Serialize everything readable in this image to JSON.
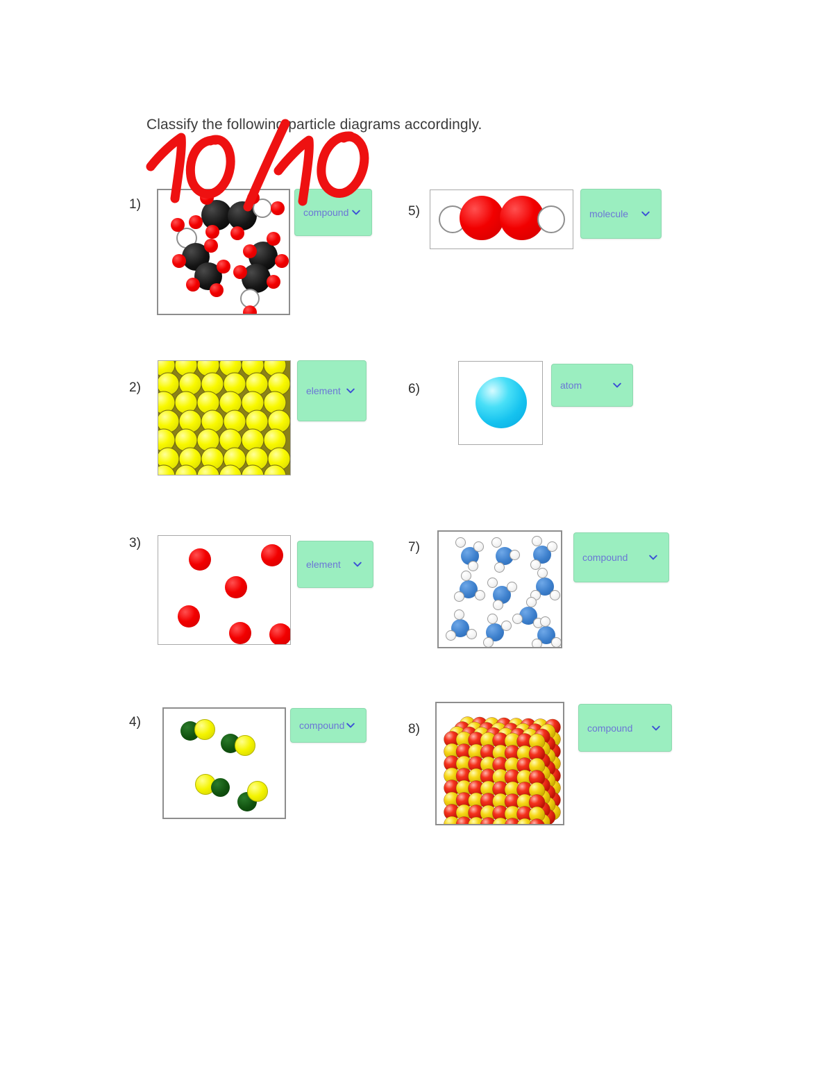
{
  "document": {
    "title": "Classify the following particle diagrams accordingly.",
    "grade_annotation": "10/10",
    "grade_color": "#ee1111"
  },
  "dropdown_options": [
    "atom",
    "molecule",
    "element",
    "compound"
  ],
  "dropdown_style": {
    "background": "#9beec0",
    "text_color": "#6b76d6",
    "chevron_color": "#3b4fd6"
  },
  "questions": [
    {
      "number": "1)",
      "answer": "compound",
      "diagram": "carbon-oxygen-hydrogen molecules",
      "column": "left"
    },
    {
      "number": "2)",
      "answer": "element",
      "diagram": "yellow close-packed metal lattice",
      "column": "left"
    },
    {
      "number": "3)",
      "answer": "element",
      "diagram": "six separate red atoms",
      "column": "left"
    },
    {
      "number": "4)",
      "answer": "compound",
      "diagram": "four green-yellow diatomic molecules",
      "column": "left"
    },
    {
      "number": "5)",
      "answer": "molecule",
      "diagram": "hydrogen peroxide H-O-O-H",
      "column": "right"
    },
    {
      "number": "6)",
      "answer": "atom",
      "diagram": "single cyan sphere",
      "column": "right"
    },
    {
      "number": "7)",
      "answer": "compound",
      "diagram": "eleven ammonia NH3 molecules",
      "column": "right"
    },
    {
      "number": "8)",
      "answer": "compound",
      "diagram": "red and yellow ionic crystal lattice",
      "column": "right"
    }
  ]
}
